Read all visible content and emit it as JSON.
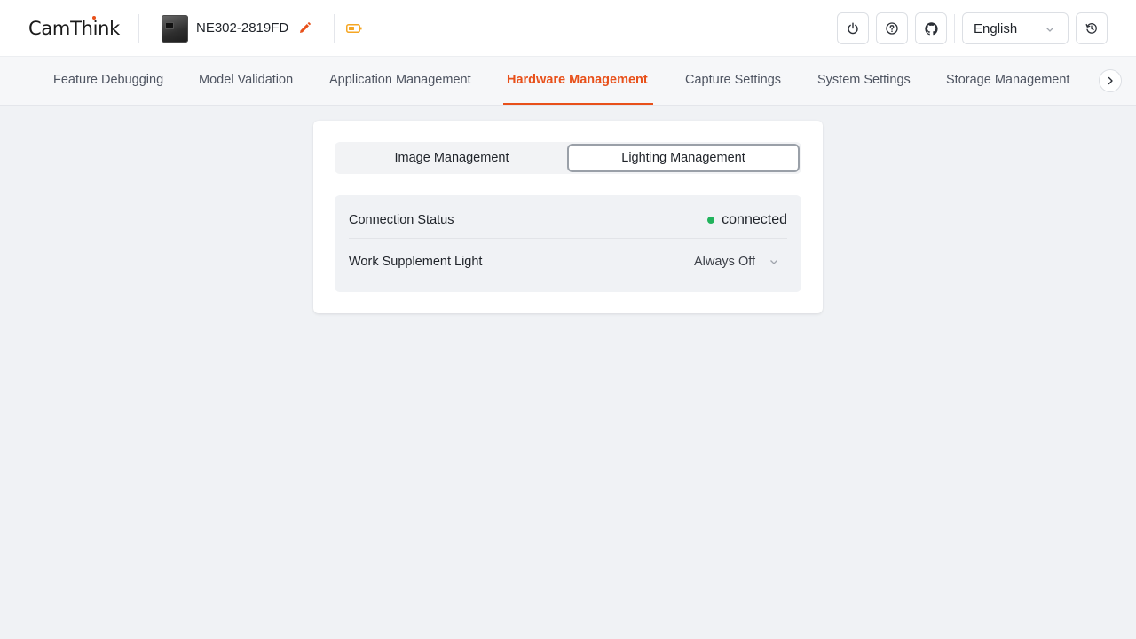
{
  "header": {
    "logo": "CamThink",
    "device_name": "NE302-2819FD",
    "language": "English",
    "icons": {
      "edit": "pencil-icon",
      "battery": "battery-icon",
      "power": "power-icon",
      "help": "help-circle-icon",
      "github": "github-icon",
      "history": "history-icon"
    }
  },
  "nav": {
    "tabs": [
      {
        "label": "Feature Debugging"
      },
      {
        "label": "Model Validation"
      },
      {
        "label": "Application Management"
      },
      {
        "label": "Hardware Management",
        "active": true
      },
      {
        "label": "Capture Settings"
      },
      {
        "label": "System Settings"
      },
      {
        "label": "Storage Management"
      }
    ]
  },
  "panel": {
    "tabs": [
      {
        "label": "Image Management"
      },
      {
        "label": "Lighting Management",
        "active": true
      }
    ],
    "connection": {
      "label": "Connection Status",
      "value": "connected"
    },
    "supplement_light": {
      "label": "Work Supplement Light",
      "value": "Always Off"
    }
  },
  "colors": {
    "accent": "#e8501a",
    "status_ok": "#21b35c",
    "battery": "#f5a623",
    "background": "#f0f2f5"
  }
}
